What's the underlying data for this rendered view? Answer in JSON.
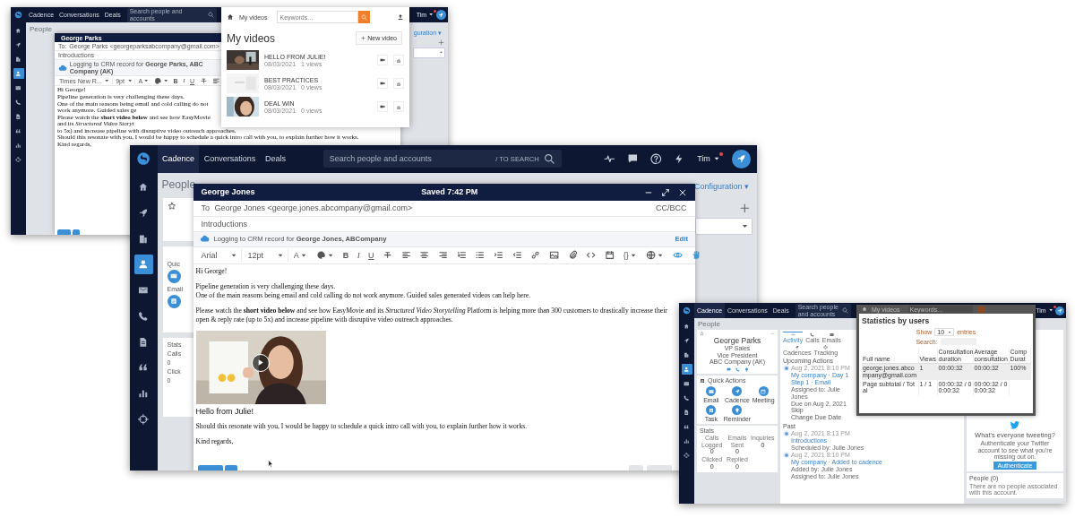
{
  "back_screenshot": {
    "nav": {
      "tabs": [
        {
          "label": "Cadence",
          "selected": false
        },
        {
          "label": "Conversations",
          "selected": false
        },
        {
          "label": "Deals",
          "selected": false
        }
      ],
      "search_placeholder": "Search people and accounts",
      "user": "Tim"
    },
    "sidebar": [
      {
        "selected": false
      },
      {
        "selected": false
      },
      {
        "selected": false
      },
      {
        "selected": true
      },
      {
        "selected": false
      },
      {
        "selected": false
      },
      {
        "selected": false
      },
      {
        "selected": false
      },
      {
        "selected": false
      },
      {
        "selected": false
      }
    ],
    "page_title": "People",
    "configuration": "guration ▾",
    "email": {
      "recipient": "George Parks",
      "to_label": "To:",
      "to": "George Parks <georgeparksabcompany@gmail.com>",
      "subject": "Introductions",
      "crm_notice": "Logging to CRM record for **George Parks, ABC Company (AK)**",
      "toolbar": [
        {
          "kind": "dropdown",
          "label": "Times New R..."
        },
        {
          "kind": "dropdown",
          "label": "9pt"
        },
        {
          "kind": "glyph",
          "label": "A",
          "caret": true
        },
        {
          "kind": "icon",
          "caret": true
        },
        {
          "kind": "bold",
          "label": "B",
          "caret": false
        },
        {
          "kind": "italic",
          "label": "I",
          "caret": false
        },
        {
          "kind": "underline",
          "label": "U",
          "caret": false
        },
        {
          "kind": "icon",
          "caret": false
        },
        {
          "kind": "icon",
          "caret": false
        }
      ],
      "body": [
        {
          "kind": "text",
          "lines": [
            "Hi George!"
          ]
        },
        {
          "kind": "text",
          "lines": [
            "Pipeline generation is very challenging these days."
          ]
        },
        {
          "kind": "text",
          "lines": [
            "One of the main reasons being email and cold calling do not work anymore. Guided sales ge"
          ]
        },
        {
          "kind": "text",
          "lines": [
            "Please watch the **short video below** and see how EasyMovie and its *Structured Video Storyt*",
            "to 5x) and increase pipeline with disruptive video outreach approaches."
          ]
        },
        {
          "kind": "text",
          "lines": [
            "Should this resonate with you, I would be happy to schedule a quick intro call with you, to explain further how it works."
          ]
        },
        {
          "kind": "text",
          "lines": [
            "Kind regards,"
          ]
        }
      ]
    },
    "videos_popup": {
      "nav_label": "My videos",
      "keywords_placeholder": "Keywords...",
      "title": "My videos",
      "new_button": "New video",
      "videos": [
        {
          "title": "HELLO FROM JULIE!",
          "date": "08/03/2021",
          "views": "1 views"
        },
        {
          "title": "BEST PRACTICES",
          "date": "08/03/2021",
          "views": "0 views"
        },
        {
          "title": "DEAL WIN",
          "date": "08/03/2021",
          "views": "0 views"
        }
      ]
    }
  },
  "main_screenshot": {
    "nav": {
      "tabs": [
        {
          "label": "Cadence",
          "selected": true
        },
        {
          "label": "Conversations",
          "selected": false
        },
        {
          "label": "Deals",
          "selected": false
        }
      ],
      "search_placeholder": "Search people and accounts",
      "search_hint": "/ TO SEARCH",
      "user": "Tim"
    },
    "sidebar": [
      {
        "selected": false
      },
      {
        "selected": false
      },
      {
        "selected": false
      },
      {
        "selected": true
      },
      {
        "selected": false
      },
      {
        "selected": false
      },
      {
        "selected": false
      },
      {
        "selected": false
      },
      {
        "selected": false
      },
      {
        "selected": false
      }
    ],
    "page_title": "People",
    "configuration": "Configuration ▾",
    "left_panel": {
      "quick_actions": "Quic",
      "action_label": "Email",
      "stats": "Stats",
      "stat_items": [
        {
          "label": "Calls",
          "value": "0"
        },
        {
          "label": "Click",
          "value": "0"
        }
      ]
    },
    "email": {
      "recipient": "George Jones",
      "saved": "Saved 7:42 PM",
      "to_label": "To",
      "to": "George Jones <george.jones.abcompany@gmail.com>",
      "cc": "CC/BCC",
      "subject": "Introductions",
      "crm_notice": "Logging to CRM record for **George Jones, ABCompany**",
      "crm_action": "Edit",
      "toolbar": [
        {
          "kind": "dropdown",
          "label": "Arial"
        },
        {
          "kind": "dropdown",
          "label": "12pt"
        },
        {
          "kind": "glyph",
          "label": "A",
          "caret": true
        },
        {
          "kind": "icon",
          "caret": true
        },
        {
          "kind": "bold",
          "label": "B",
          "caret": false
        },
        {
          "kind": "italic",
          "label": "I",
          "caret": false
        },
        {
          "kind": "underline",
          "label": "U",
          "caret": false
        },
        {
          "kind": "icon",
          "caret": false
        },
        {
          "kind": "icon",
          "caret": false
        },
        {
          "kind": "icon",
          "caret": false
        },
        {
          "kind": "icon",
          "caret": false
        },
        {
          "kind": "icon",
          "caret": false
        },
        {
          "kind": "icon",
          "caret": false
        },
        {
          "kind": "icon",
          "caret": false
        },
        {
          "kind": "icon",
          "caret": false
        },
        {
          "kind": "icon",
          "caret": false
        },
        {
          "kind": "icon",
          "caret": false
        },
        {
          "kind": "icon",
          "caret": false
        },
        {
          "kind": "icon",
          "caret": false
        },
        {
          "kind": "icon",
          "caret": false
        },
        {
          "kind": "glyph",
          "label": "{}",
          "caret": true
        },
        {
          "kind": "icon",
          "caret": true
        },
        {
          "kind": "icon",
          "caret": false
        },
        {
          "kind": "icon",
          "caret": false
        }
      ],
      "body": [
        {
          "kind": "text",
          "lines": [
            "Hi George!"
          ]
        },
        {
          "kind": "text",
          "lines": [
            "Pipeline generation is very challenging these days.",
            "One of the main reasons being email and cold calling do not work anymore. Guided sales generated videos can help here."
          ]
        },
        {
          "kind": "text",
          "lines": [
            "Please watch the **short video below** and see how EasyMovie and its *Structured Video Storytelling* Platform is helping more than 300 customers to drastically increase their open & reply rate (up to 5x) and increase pipeline with disruptive video outreach approaches."
          ]
        },
        {
          "kind": "video",
          "caption": "Hello from Julie!"
        },
        {
          "kind": "text",
          "lines": [
            "Should this resonate with you, I would be happy to schedule a quick intro call with you, to explain further how it works."
          ]
        },
        {
          "kind": "text",
          "lines": [
            "Kind regards,"
          ]
        }
      ]
    }
  },
  "right_screenshot": {
    "nav": {
      "tabs": [
        {
          "label": "Cadence",
          "selected": true
        },
        {
          "label": "Conversations",
          "selected": false
        },
        {
          "label": "Deals",
          "selected": false
        }
      ],
      "search_placeholder": "Search people and accounts",
      "user": "Tim"
    },
    "sidebar": [
      {
        "selected": false
      },
      {
        "selected": false
      },
      {
        "selected": false
      },
      {
        "selected": true
      },
      {
        "selected": false
      },
      {
        "selected": false
      },
      {
        "selected": false
      },
      {
        "selected": false
      },
      {
        "selected": false
      },
      {
        "selected": false
      }
    ],
    "page_title": "People",
    "contact": {
      "name": "George Parks",
      "details": [
        "VP Sales",
        "Vice President",
        "ABC Company (AK)"
      ]
    },
    "quick_actions": {
      "title": "Quick Actions",
      "actions": [
        "Email",
        "Cadence",
        "Meeting",
        "Task",
        "Reminder"
      ]
    },
    "stats": {
      "title": "Stats",
      "items": [
        {
          "label": "Calls Logged",
          "value": "0"
        },
        {
          "label": "Emails Sent",
          "value": "0"
        },
        {
          "label": "Inquiries",
          "value": "0"
        },
        {
          "label": "Clicked",
          "value": "0"
        },
        {
          "label": "Replied",
          "value": "0"
        }
      ]
    },
    "activity_tabs": [
      {
        "label": "Activity",
        "selected": true
      },
      {
        "label": "Calls",
        "selected": false
      },
      {
        "label": "Emails",
        "selected": false
      },
      {
        "label": "Cadences",
        "selected": false
      },
      {
        "label": "Tracking",
        "selected": false
      }
    ],
    "upcoming": {
      "title": "Upcoming Actions",
      "items": [
        {
          "time": "Aug 2, 2021 8:10 PM",
          "title": "My company · Day 1 Step 1 · Email",
          "lines": [
            "Assigned to: Julie Jones",
            "Due on Aug 2, 2021"
          ],
          "actions": [
            "Skip",
            "Change Due Date"
          ]
        }
      ]
    },
    "past": {
      "title": "Past",
      "items": [
        {
          "time": "Aug 2, 2021 8:13 PM",
          "title": "Introductions",
          "lines": [
            "Scheduled by: Julie Jones"
          ]
        },
        {
          "time": "Aug 2, 2021 8:10 PM",
          "title": "My company · Added to cadence",
          "lines": [
            "Added by: Julie Jones",
            "Assigned to: Julie Jones"
          ]
        }
      ]
    },
    "twitter": {
      "heading": "What's everyone tweeting?",
      "text": "Authenticate your Twitter account to see what you're missing out on.",
      "button": "Authenticate"
    },
    "people": {
      "title": "People (0)",
      "text": "There are no people associated with this account."
    },
    "stats_modal": {
      "behind": {
        "nav_label": "My videos",
        "keywords_placeholder": "Keywords..."
      },
      "title": "Statistics by users",
      "show_label": "Show",
      "page_size": "10",
      "entries_label": "entries",
      "search_label": "Search:",
      "columns": [
        "Full name",
        "Views",
        "Consultation duration",
        "Average consultation",
        "Comp Durat"
      ],
      "rows": [
        {
          "cells": [
            "george.jones.abcompany@gmail.com",
            "1",
            "00:00:32",
            "00:00:32",
            "100%"
          ],
          "selected": true
        },
        {
          "cells": [
            "Page subtotal / Total",
            "1 / 1",
            "00:00:32 / 00:00:32",
            "00:00:32 / 00:00:32"
          ],
          "selected": false
        }
      ]
    }
  }
}
